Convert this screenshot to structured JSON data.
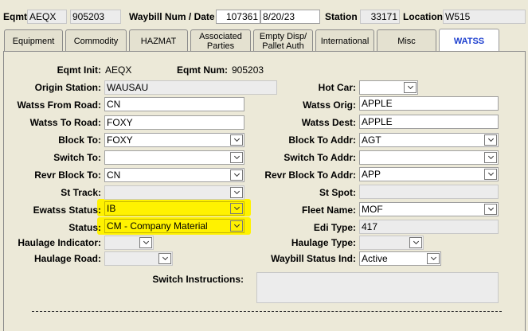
{
  "header": {
    "eqmt_label": "Eqmt",
    "eqmt_init": "AEQX",
    "eqmt_num": "905203",
    "waybill_label": "Waybill Num / Date",
    "waybill_num": "107361",
    "waybill_date": "8/20/23",
    "station_label": "Station",
    "station_value": "33171",
    "location_label": "Location",
    "location_value": "W515"
  },
  "tabs": [
    {
      "label": "Equipment"
    },
    {
      "label": "Commodity"
    },
    {
      "label": "HAZMAT"
    },
    {
      "label": "Associated Parties"
    },
    {
      "label": "Empty Disp/ Pallet Auth"
    },
    {
      "label": "International"
    },
    {
      "label": "Misc"
    },
    {
      "label": "WATSS",
      "active": true
    }
  ],
  "form": {
    "eqmt_init_label": "Eqmt Init:",
    "eqmt_init_value": "AEQX",
    "eqmt_num_label": "Eqmt Num:",
    "eqmt_num_value": "905203",
    "origin_station_label": "Origin Station:",
    "origin_station_value": "WAUSAU",
    "hot_car_label": "Hot Car:",
    "hot_car_value": "",
    "watss_from_road_label": "Watss From Road:",
    "watss_from_road_value": "CN",
    "watss_orig_label": "Watss Orig:",
    "watss_orig_value": "APPLE",
    "watss_to_road_label": "Watss To Road:",
    "watss_to_road_value": "FOXY",
    "watss_dest_label": "Watss Dest:",
    "watss_dest_value": "APPLE",
    "block_to_label": "Block To:",
    "block_to_value": "FOXY",
    "block_to_addr_label": "Block To Addr:",
    "block_to_addr_value": "AGT",
    "switch_to_label": "Switch To:",
    "switch_to_value": "",
    "switch_to_addr_label": "Switch To Addr:",
    "switch_to_addr_value": "",
    "revr_block_to_label": "Revr Block To:",
    "revr_block_to_value": "CN",
    "revr_block_to_addr_label": "Revr Block To Addr:",
    "revr_block_to_addr_value": "APP",
    "st_track_label": "St Track:",
    "st_track_value": "",
    "st_spot_label": "St Spot:",
    "st_spot_value": "",
    "ewatss_status_label": "Ewatss Status:",
    "ewatss_status_value": "IB",
    "fleet_name_label": "Fleet Name:",
    "fleet_name_value": "MOF",
    "status_label": "Status:",
    "status_value": "CM - Company Material",
    "edi_type_label": "Edi Type:",
    "edi_type_value": "417",
    "haulage_indicator_label": "Haulage Indicator:",
    "haulage_indicator_value": "",
    "haulage_type_label": "Haulage Type:",
    "haulage_type_value": "",
    "haulage_road_label": "Haulage Road:",
    "haulage_road_value": "",
    "waybill_status_ind_label": "Waybill Status Ind:",
    "waybill_status_ind_value": "Active",
    "switch_instructions_label": "Switch Instructions:",
    "switch_instructions_value": ""
  },
  "colors": {
    "background": "#ece9d8",
    "highlight": "#fff200",
    "active_tab_text": "#1d3fcf"
  }
}
